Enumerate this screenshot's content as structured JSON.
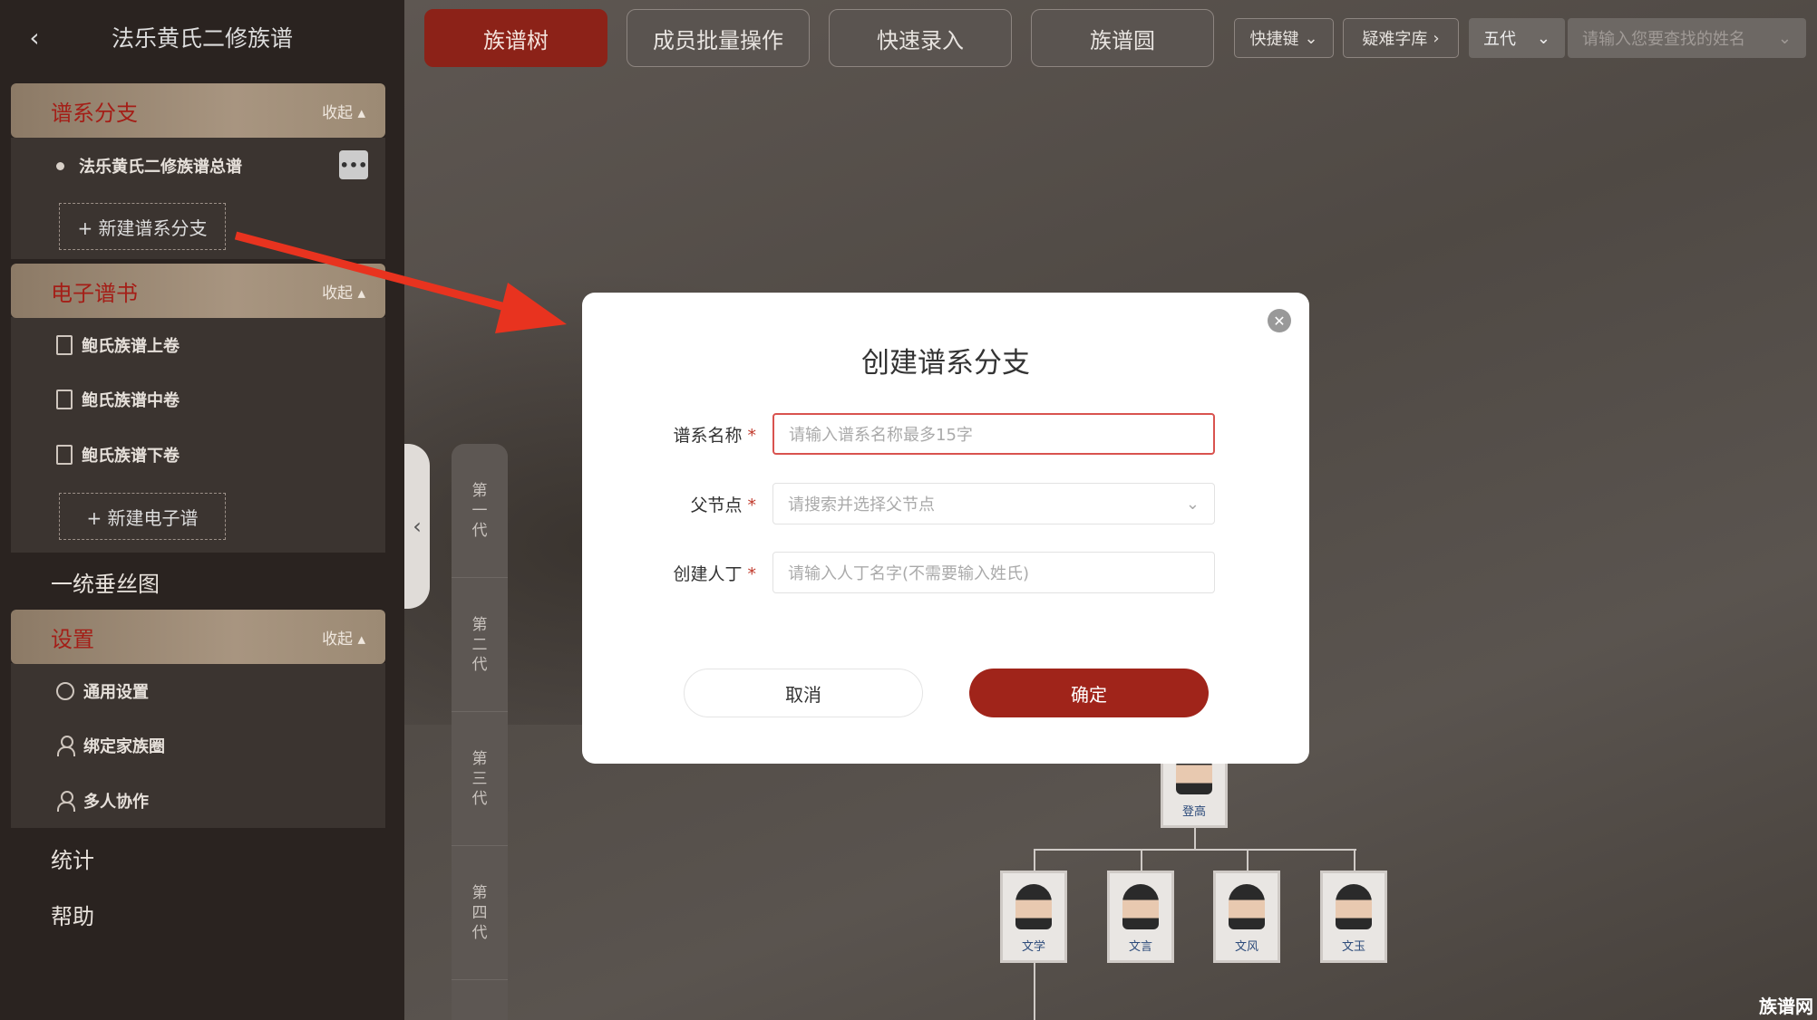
{
  "sidebar": {
    "title": "法乐黄氏二修族谱",
    "sections": [
      {
        "title": "谱系分支",
        "collapse": "收起"
      },
      {
        "title": "电子谱书",
        "collapse": "收起"
      },
      {
        "title": "设置",
        "collapse": "收起"
      }
    ],
    "branch_item": "法乐黄氏二修族谱总谱",
    "new_branch": "+ 新建谱系分支",
    "books": [
      "鲍氏族谱上卷",
      "鲍氏族谱中卷",
      "鲍氏族谱下卷"
    ],
    "new_book": "+ 新建电子谱",
    "unified": "一统垂丝图",
    "settings": [
      "通用设置",
      "绑定家族圈",
      "多人协作"
    ],
    "stats": "统计",
    "help": "帮助"
  },
  "toolbar": {
    "tabs": [
      "族谱树",
      "成员批量操作",
      "快速录入",
      "族谱圆"
    ],
    "shortcut": "快捷键",
    "rare_chars": "疑难字库",
    "generation_select": "五代",
    "search_placeholder": "请输入您要查找的姓名"
  },
  "generations": [
    "第一代",
    "第二代",
    "第三代",
    "第四代"
  ],
  "tree": {
    "root": "登高",
    "children": [
      "文学",
      "文言",
      "文风",
      "文玉"
    ]
  },
  "dialog": {
    "title": "创建谱系分支",
    "fields": [
      {
        "label": "谱系名称",
        "placeholder": "请输入谱系名称最多15字"
      },
      {
        "label": "父节点",
        "placeholder": "请搜索并选择父节点"
      },
      {
        "label": "创建人丁",
        "placeholder": "请输入人丁名字(不需要输入姓氏)"
      }
    ],
    "cancel": "取消",
    "confirm": "确定"
  },
  "watermark": "族谱网",
  "colors": {
    "accent": "#a0241a",
    "sidebar_bg": "#2a2320"
  }
}
